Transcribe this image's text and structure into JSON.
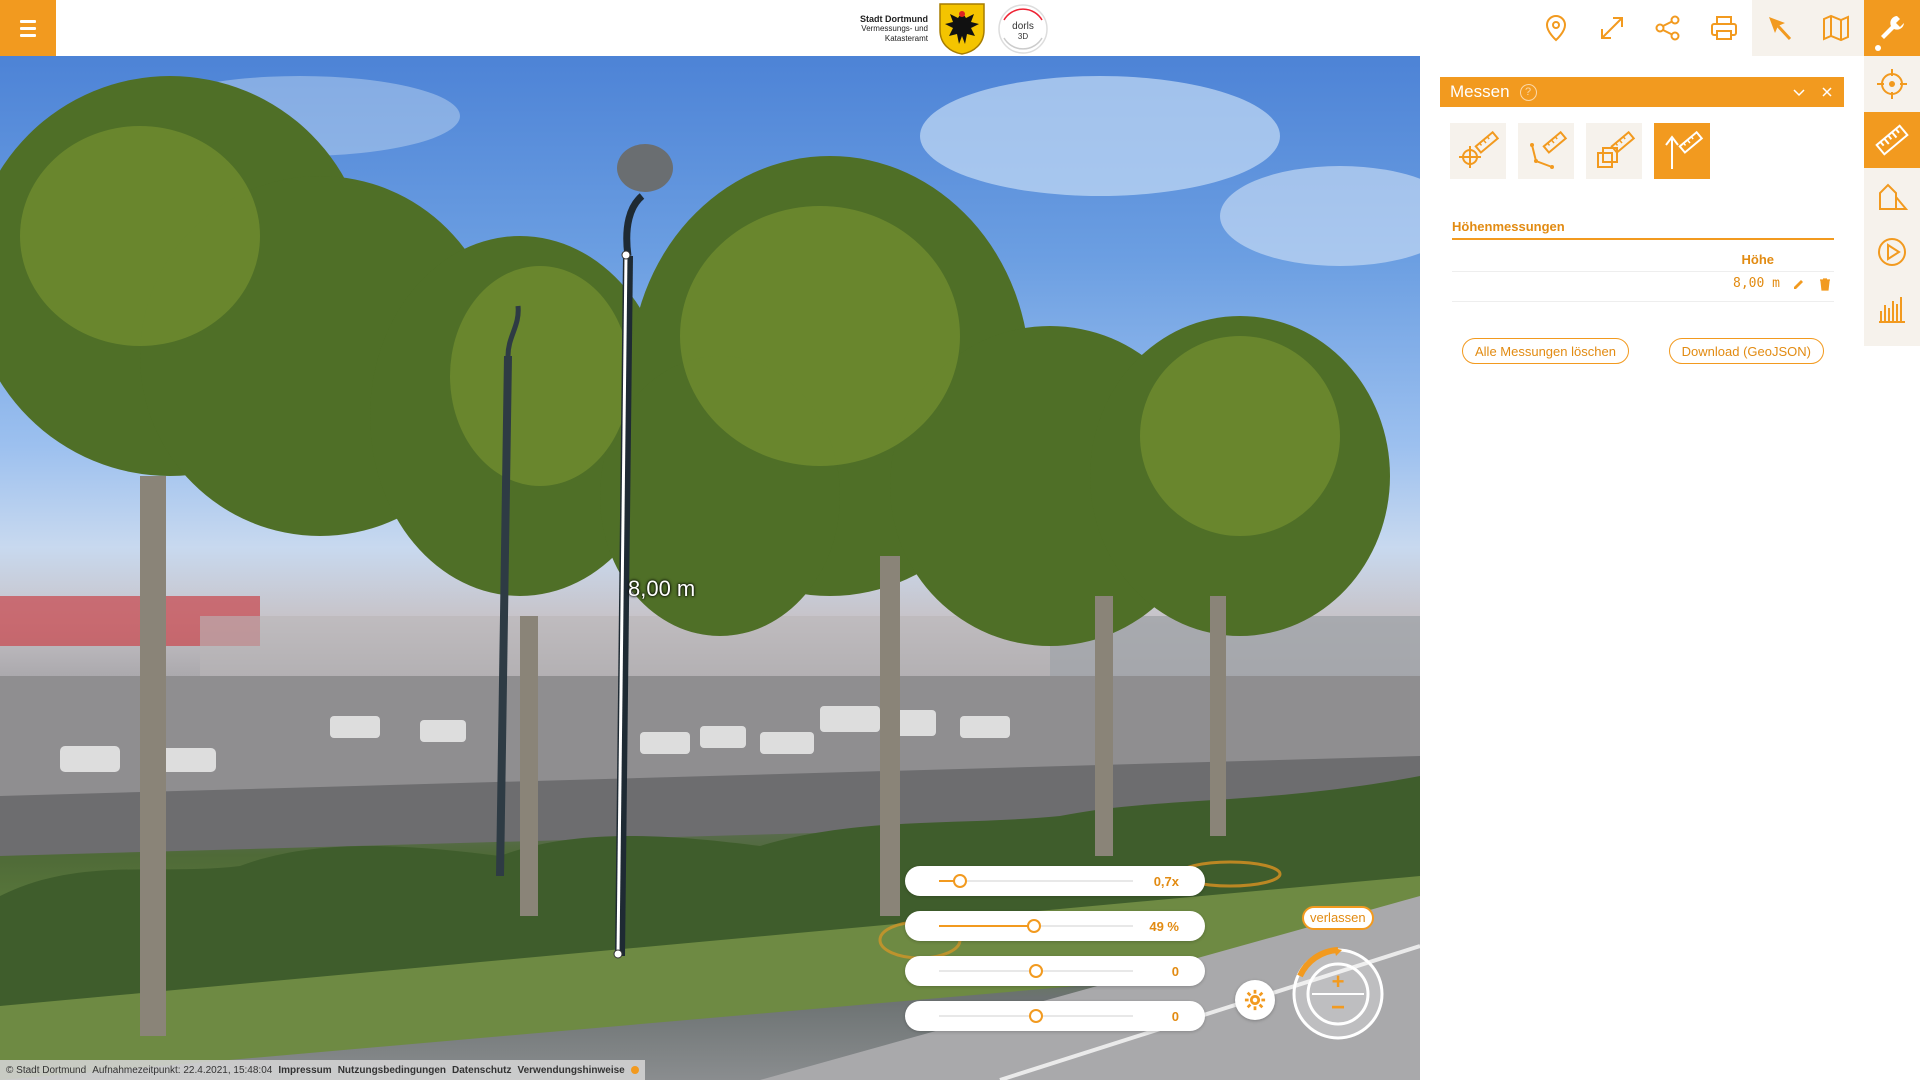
{
  "header": {
    "menu_icon": "hamburger-icon",
    "logo": {
      "line1": "Stadt Dortmund",
      "line2": "Vermessungs- und",
      "line3": "Katasteramt",
      "dorls_line1": "dorls",
      "dorls_line2": "3D"
    },
    "toolbar_icons": [
      "location-pin-icon",
      "fullscreen-icon",
      "share-icon",
      "print-icon",
      "cursor-select-icon",
      "map-icon",
      "wrench-icon"
    ]
  },
  "side_toolbar": {
    "items": [
      "crosshair-icon",
      "ruler-icon",
      "house-shadow-icon",
      "play-icon",
      "profile-icon"
    ],
    "active": "ruler-icon"
  },
  "viewport": {
    "measure_label": "8,00 m",
    "sliders": [
      {
        "value_label": "0,7x",
        "fraction": 0.11
      },
      {
        "value_label": "49 %",
        "fraction": 0.49
      },
      {
        "value_label": "0",
        "fraction": 0.5
      },
      {
        "value_label": "0",
        "fraction": 0.5
      }
    ],
    "leave_label": "verlassen",
    "zoom_plus": "+",
    "zoom_minus": "−"
  },
  "footer": {
    "copyright": "© Stadt Dortmund",
    "capture_time": "Aufnahmezeitpunkt: 22.4.2021, 15:48:04",
    "links": [
      "Impressum",
      "Nutzungsbedingungen",
      "Datenschutz",
      "Verwendungshinweise"
    ]
  },
  "panel": {
    "title": "Messen",
    "help": "?",
    "tools": [
      "point-measure-icon",
      "distance-measure-icon",
      "area-measure-icon",
      "height-measure-icon"
    ],
    "active_tool": "height-measure-icon",
    "section_title": "Höhenmessungen",
    "column_header": "Höhe",
    "rows": [
      {
        "value": "8,00 m"
      }
    ],
    "clear_all_label": "Alle Messungen löschen",
    "download_label": "Download (GeoJSON)"
  },
  "colors": {
    "accent": "#f29a1f",
    "soft": "#f6f2ec"
  }
}
